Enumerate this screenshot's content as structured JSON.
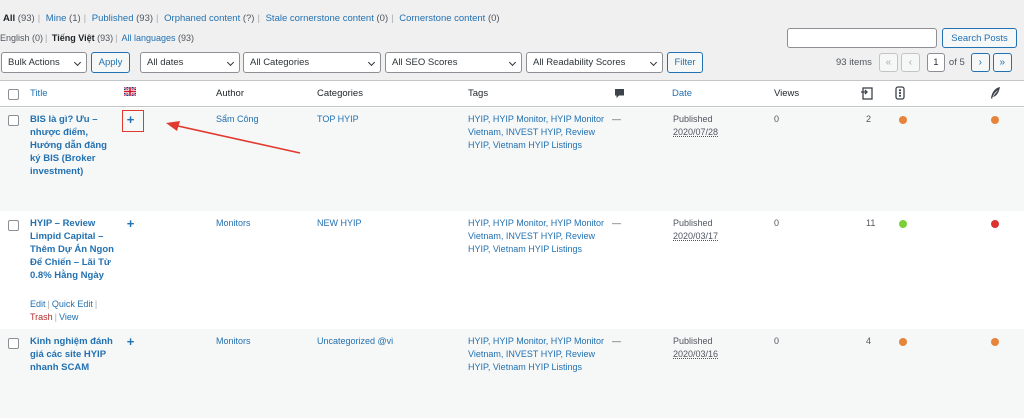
{
  "filters": {
    "views": [
      {
        "label": "All",
        "count": "(93)",
        "current": true
      },
      {
        "label": "Mine",
        "count": "(1)"
      },
      {
        "label": "Published",
        "count": "(93)"
      },
      {
        "label": "Orphaned content",
        "count": "(?)"
      },
      {
        "label": "Stale cornerstone content",
        "count": "(0)"
      },
      {
        "label": "Cornerstone content",
        "count": "(0)"
      }
    ],
    "languages": [
      {
        "label": "English",
        "count": "(0)"
      },
      {
        "label": "Tiếng Việt",
        "count": "(93)",
        "current": true
      },
      {
        "label": "All languages",
        "count": "(93)"
      }
    ]
  },
  "search": {
    "placeholder": "",
    "button": "Search Posts"
  },
  "toolbar": {
    "bulk_actions": "Bulk Actions",
    "apply": "Apply",
    "dates": "All dates",
    "categories": "All Categories",
    "seo_scores": "All SEO Scores",
    "readability_scores": "All Readability Scores",
    "filter": "Filter",
    "items": "93 items",
    "page": "1",
    "of_pages": "of 5",
    "first": "«",
    "prev": "‹",
    "next": "›",
    "last": "»"
  },
  "columns": {
    "title": "Title",
    "author": "Author",
    "categories": "Categories",
    "tags": "Tags",
    "date": "Date",
    "views": "Views"
  },
  "icons": {
    "flag": "uk-flag-icon",
    "comments": "comment-bubble-icon",
    "links": "internal-links-icon",
    "seo": "seo-traffic-light-icon",
    "readability": "readability-feather-icon"
  },
  "colors": {
    "link": "#2271b1",
    "orange": "#e7843c",
    "green": "#7ad03a",
    "red": "#dc3232",
    "annotation": "#e03a2f"
  },
  "posts": [
    {
      "title": "BIS là gì? Ưu – nhược điểm, Hướng dẫn đăng ký BIS (Broker investment)",
      "translate": "+",
      "author": "Sẩm Công",
      "category": "TOP HYIP",
      "tags": "HYIP, HYIP Monitor, HYIP Monitor Vietnam, INVEST HYIP, Review HYIP, Vietnam HYIP Listings",
      "comments": "—",
      "status": "Published",
      "date": "2020/07/28",
      "views": "0",
      "links": "2",
      "seo": "orange",
      "readability": "orange"
    },
    {
      "title": "HYIP – Review Limpid Capital – Thêm Dự Án Ngon Để Chiến – Lãi Từ 0.8% Hằng Ngày",
      "translate": "+",
      "author": "Monitors",
      "category": "NEW HYIP",
      "tags": "HYIP, HYIP Monitor, HYIP Monitor Vietnam, INVEST HYIP, Review HYIP, Vietnam HYIP Listings",
      "comments": "—",
      "status": "Published",
      "date": "2020/03/17",
      "views": "0",
      "links": "11",
      "seo": "green",
      "readability": "red",
      "actions": {
        "edit": "Edit",
        "quick_edit": "Quick Edit",
        "trash": "Trash",
        "view": "View"
      }
    },
    {
      "title": "Kinh nghiệm đánh giá các site HYIP nhanh SCAM",
      "translate": "+",
      "author": "Monitors",
      "category": "Uncategorized @vi",
      "tags": "HYIP, HYIP Monitor, HYIP Monitor Vietnam, INVEST HYIP, Review HYIP, Vietnam HYIP Listings",
      "comments": "—",
      "status": "Published",
      "date": "2020/03/16",
      "views": "0",
      "links": "4",
      "seo": "orange",
      "readability": "orange"
    }
  ]
}
